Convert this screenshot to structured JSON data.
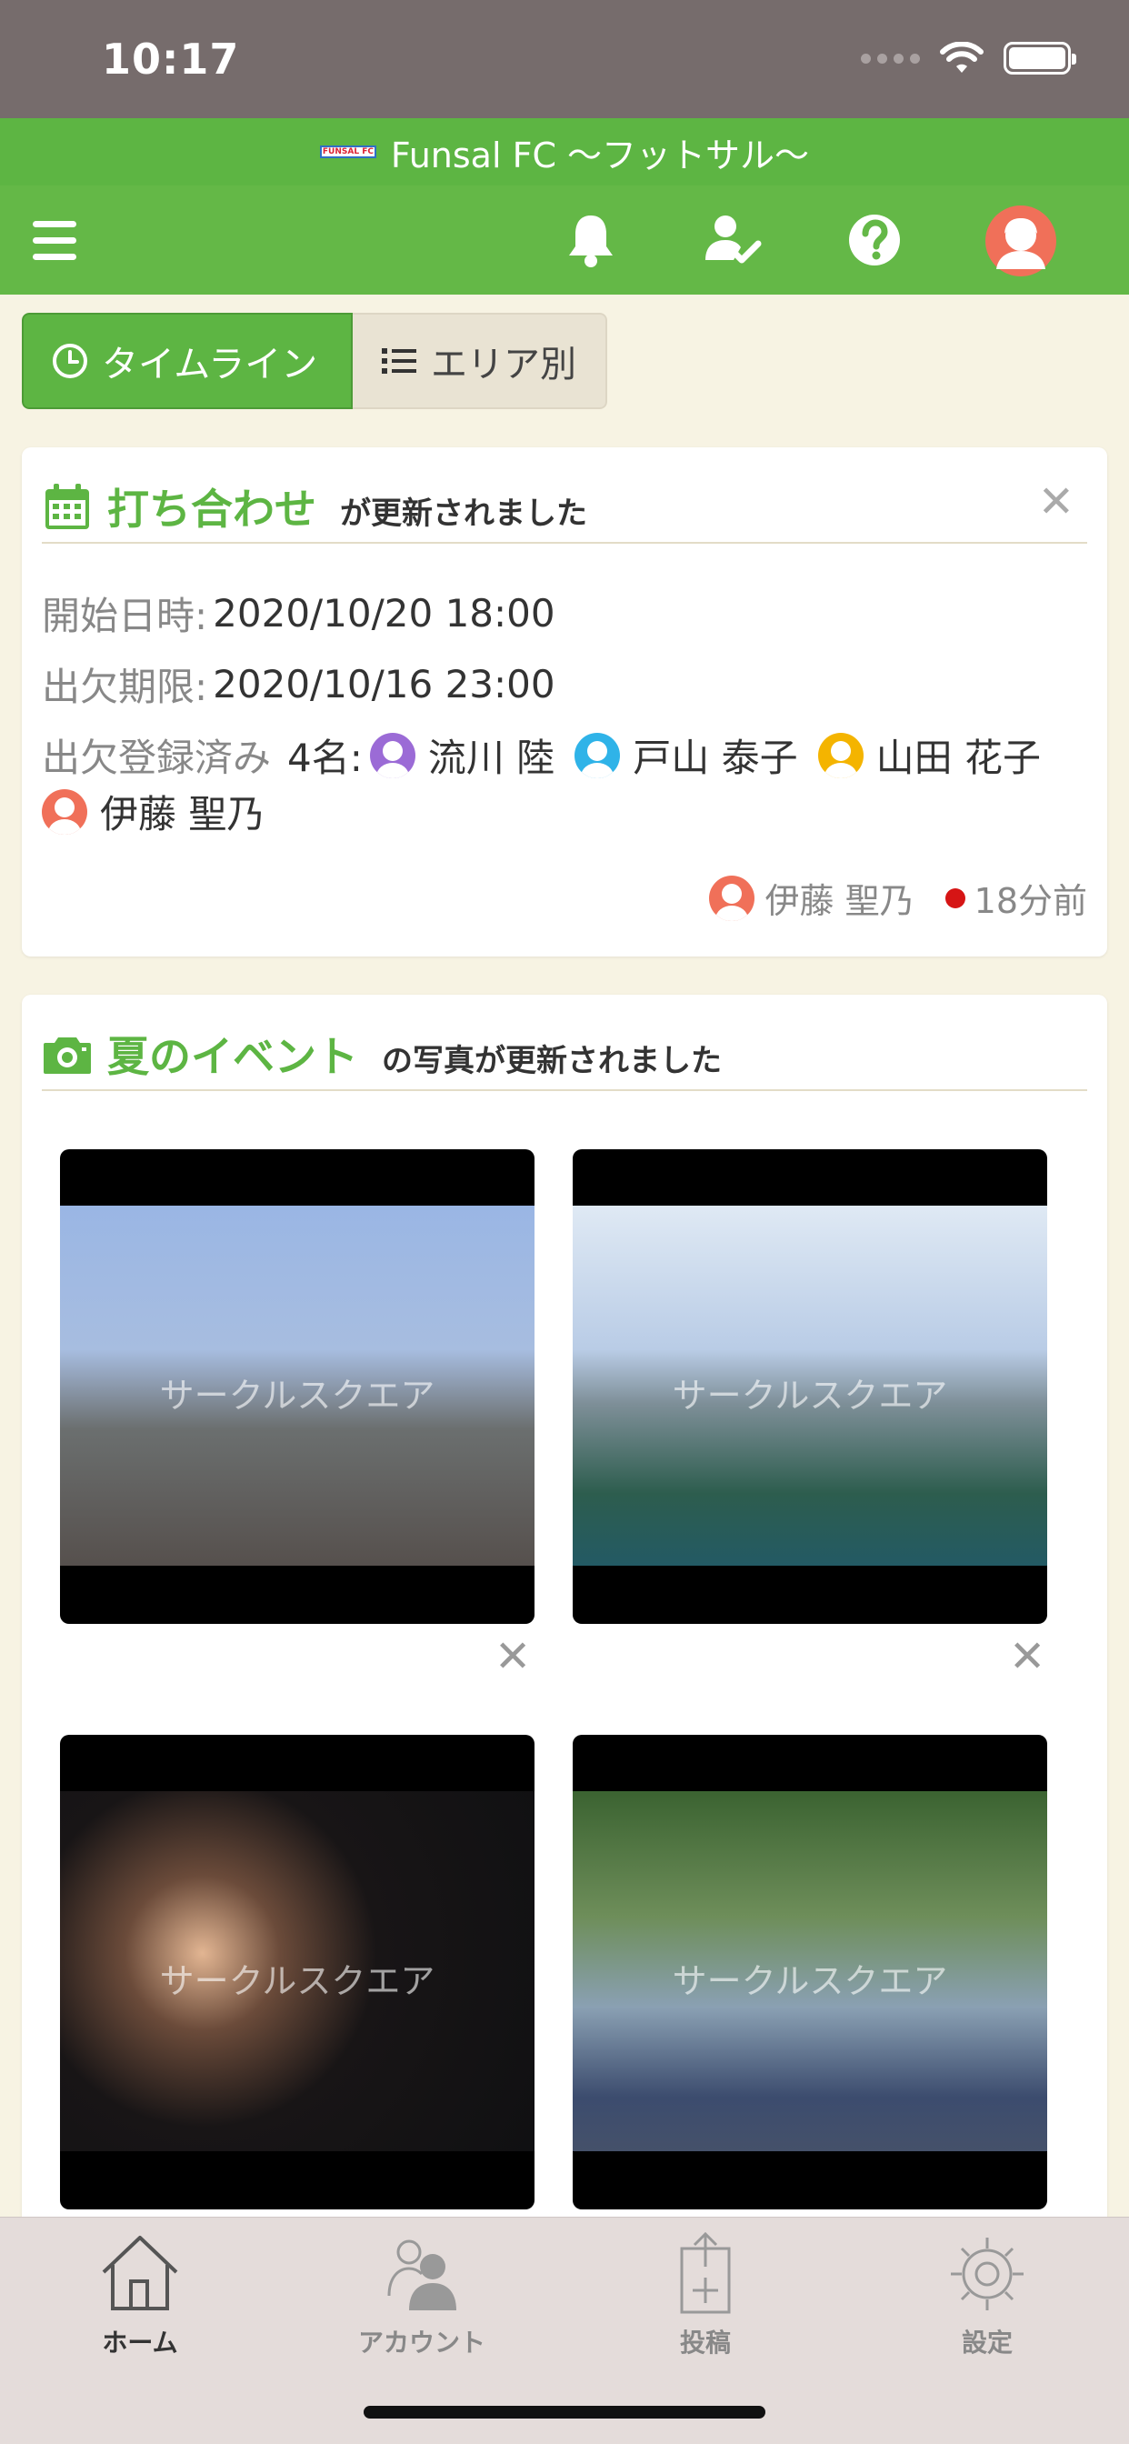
{
  "status_bar": {
    "time": "10:17"
  },
  "app": {
    "title": "Funsal FC 〜フットサル〜",
    "logo_text": "FUNSAL FC"
  },
  "toolbar": {
    "icons": [
      "menu-icon",
      "bell-icon",
      "attendance-check-icon",
      "help-icon",
      "avatar-icon"
    ]
  },
  "tabs": [
    {
      "label": "タイムライン",
      "icon": "clock-icon",
      "active": true
    },
    {
      "label": "エリア別",
      "icon": "list-icon",
      "active": false
    }
  ],
  "card1": {
    "title": "打ち合わせ",
    "title_suffix": "が更新されました",
    "start_label": "開始日時:",
    "start_value": "2020/10/20 18:00",
    "deadline_label": "出欠期限:",
    "deadline_value": "2020/10/16 23:00",
    "registered_label": "出欠登録済み",
    "registered_count": "4名:",
    "members": [
      {
        "name": "流川 陸",
        "color": "#9b6bd6"
      },
      {
        "name": "戸山 泰子",
        "color": "#2fb3e8"
      },
      {
        "name": "山田 花子",
        "color": "#f4b400"
      },
      {
        "name": "伊藤 聖乃",
        "color": "#f07059"
      }
    ],
    "footer_user": "伊藤 聖乃",
    "footer_time": "18分前"
  },
  "card2": {
    "title": "夏のイベント",
    "title_suffix": "の写真が更新されました",
    "watermark": "サークルスクエア"
  },
  "bottom_nav": [
    {
      "label": "ホーム",
      "icon": "home-icon"
    },
    {
      "label": "アカウント",
      "icon": "account-icon"
    },
    {
      "label": "投稿",
      "icon": "post-icon"
    },
    {
      "label": "設定",
      "icon": "gear-icon"
    }
  ],
  "colors": {
    "brand_green": "#5db543",
    "status_bar": "#766c6c",
    "background": "#f7f3e3"
  }
}
